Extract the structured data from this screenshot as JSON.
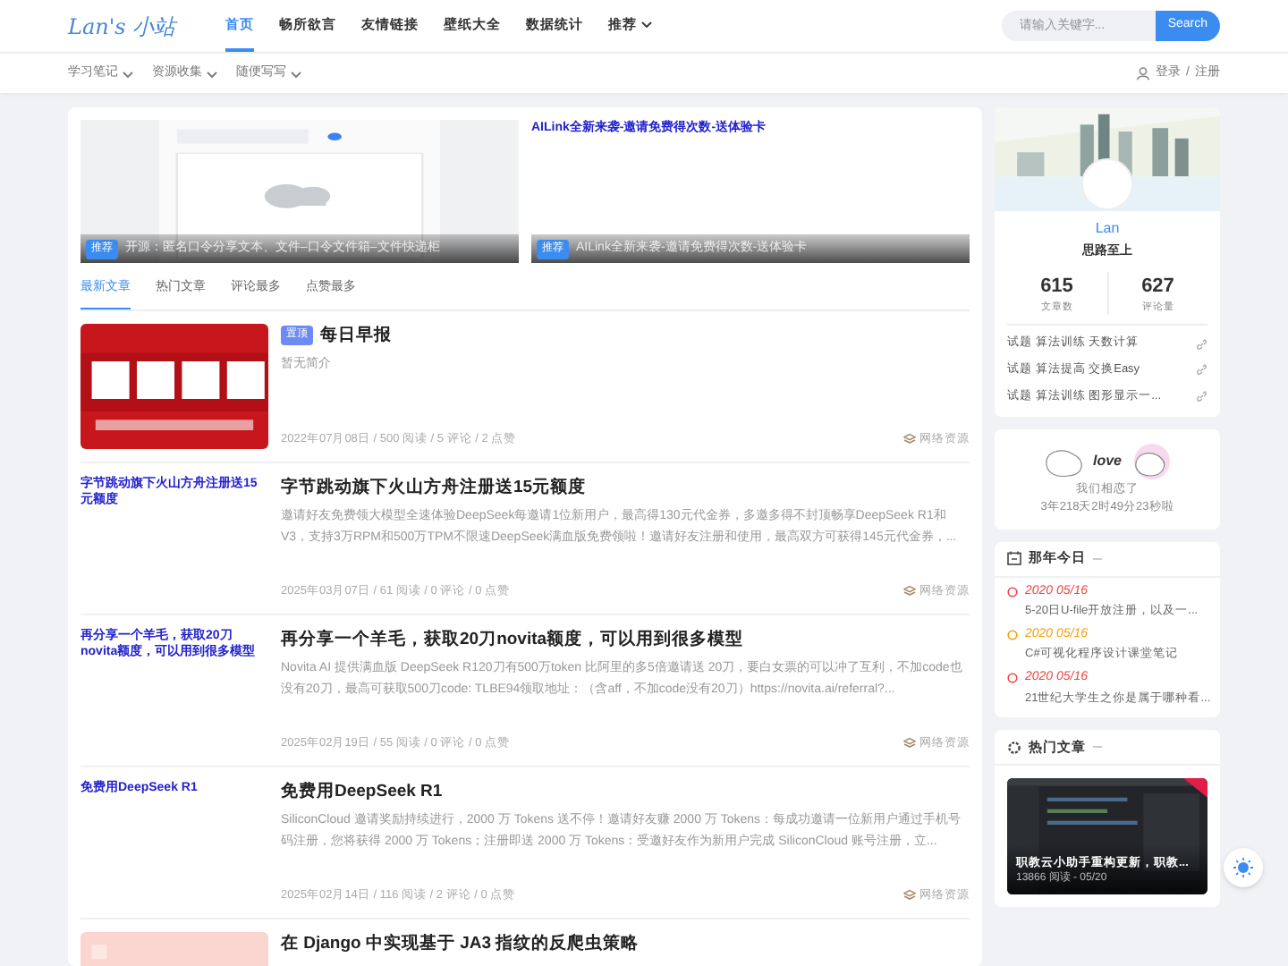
{
  "header": {
    "logo": "Lan's 小站",
    "nav": [
      {
        "label": "首页",
        "selected": true,
        "dropdown": false
      },
      {
        "label": "畅所欲言",
        "selected": false,
        "dropdown": false
      },
      {
        "label": "友情链接",
        "selected": false,
        "dropdown": false
      },
      {
        "label": "壁纸大全",
        "selected": false,
        "dropdown": false
      },
      {
        "label": "数据统计",
        "selected": false,
        "dropdown": false
      },
      {
        "label": "推荐",
        "selected": false,
        "dropdown": true
      }
    ],
    "search": {
      "placeholder": "请输入关键字...",
      "button": "Search"
    }
  },
  "subnav": {
    "items": [
      {
        "label": "学习笔记",
        "dropdown": true
      },
      {
        "label": "资源收集",
        "dropdown": true
      },
      {
        "label": "随便写写",
        "dropdown": true
      }
    ],
    "login": "登录",
    "separator": "/",
    "register": "注册"
  },
  "slides": [
    {
      "kind": "picture",
      "badge": "推荐",
      "caption": "开源：匿名口令分享文本、文件–口令文件箱–文件快递柜"
    },
    {
      "kind": "broken",
      "alt": "AILink全新来袭-邀请免费得次数-送体验卡",
      "badge": "推荐",
      "caption": "AILink全新来袭-邀请免费得次数-送体验卡"
    }
  ],
  "tabs": [
    {
      "label": "最新文章",
      "selected": true
    },
    {
      "label": "热门文章",
      "selected": false
    },
    {
      "label": "评论最多",
      "selected": false
    },
    {
      "label": "点赞最多",
      "selected": false
    }
  ],
  "articles": [
    {
      "badge": "置顶",
      "title": "每日早报",
      "excerpt": "暂无简介",
      "meta": "2022年07月08日 / 500 阅读 / 5 评论 / 2 点赞",
      "category": "网络资源"
    },
    {
      "thumb": {
        "kind": "broken",
        "alt": "字节跳动旗下火山方舟注册送15元额度"
      },
      "title": "字节跳动旗下火山方舟注册送15元额度",
      "excerpt": "邀请好友免费领大模型全速体验DeepSeek每邀请1位新用户，最高得130元代金券，多邀多得不封顶畅享DeepSeek R1和V3，支持3万RPM和500万TPM不限速DeepSeek满血版免费领啦！邀请好友注册和使用，最高双方可获得145元代金券，...",
      "meta": "2025年03月07日 / 61 阅读 / 0 评论 / 0 点赞",
      "category": "网络资源"
    },
    {
      "thumb": {
        "kind": "broken",
        "alt": "再分享一个羊毛，获取20刀novita额度，可以用到很多模型"
      },
      "title": "再分享一个羊毛，获取20刀novita额度，可以用到很多模型",
      "excerpt": "Novita AI 提供满血版 DeepSeek R120刀有500万token 比阿里的多5倍邀请送 20刀，要白女票的可以冲了互利，不加code也没有20刀，最高可获取500刀code: TLBE94领取地址：（含aff，不加code没有20刀）https://novita.ai/referral?...",
      "meta": "2025年02月19日 / 55 阅读 / 0 评论 / 0 点赞",
      "category": "网络资源"
    },
    {
      "thumb": {
        "kind": "broken",
        "alt": "免费用DeepSeek R1"
      },
      "title": "免费用DeepSeek R1",
      "excerpt": "SiliconCloud 邀请奖励持续进行，2000 万 Tokens 送不停！邀请好友赚 2000 万 Tokens：每成功邀请一位新用户通过手机号码注册，您将获得 2000 万 Tokens；注册即送 2000 万 Tokens：受邀好友作为新用户完成 SiliconCloud 账号注册，立...",
      "meta": "2025年02月14日 / 116 阅读 / 2 评论 / 0 点赞",
      "category": "网络资源"
    },
    {
      "title": "在 Django 中实现基于 JA3 指纹的反爬虫策略"
    }
  ],
  "profile": {
    "name": "Lan",
    "motto": "思路至上",
    "stats": [
      {
        "value": "615",
        "label": "文章数"
      },
      {
        "value": "627",
        "label": "评论量"
      }
    ],
    "links": [
      "试题 算法训练 天数计算",
      "试题 算法提高 交换Easy",
      "试题 算法训练 图形显示一..."
    ]
  },
  "love": {
    "word": "love",
    "text": "我们相恋了",
    "duration": "3年218天2时49分23秒啦"
  },
  "history": {
    "title": "那年今日",
    "items": [
      {
        "date": "2020 05/16",
        "text": "5-20日U-file开放注册，以及一...",
        "color": "#ef4444"
      },
      {
        "date": "2020 05/16",
        "text": "C#可视化程序设计课堂笔记",
        "color": "#f59e0b"
      },
      {
        "date": "2020 05/16",
        "text": "21世纪大学生之你是属于哪种看...",
        "color": "#ef4444"
      }
    ]
  },
  "hot": {
    "title": "热门文章",
    "items": [
      {
        "title": "职教云小助手重构更新，职教...",
        "meta": "13866 阅读 - 05/20"
      }
    ]
  }
}
